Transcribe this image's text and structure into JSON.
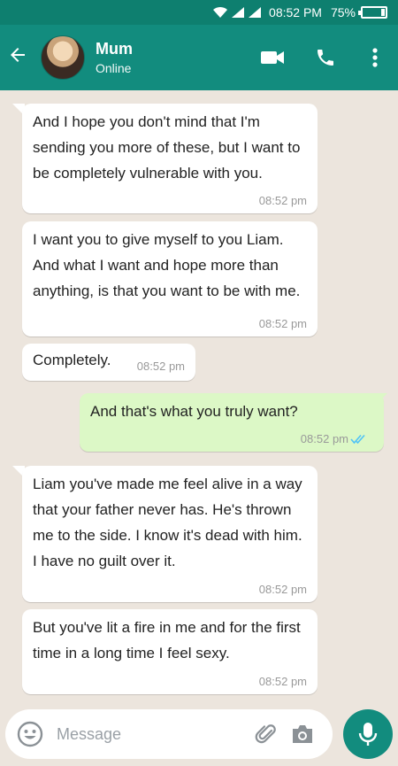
{
  "status_bar": {
    "time": "08:52 PM",
    "battery": "75%"
  },
  "header": {
    "contact_name": "Mum",
    "contact_status": "Online"
  },
  "messages": [
    {
      "direction": "in",
      "text": "And I hope you don't mind that I'm sending you more of these, but I want to be completely vulnerable with you.",
      "time": "08:52 pm"
    },
    {
      "direction": "in",
      "text": "I want you to give myself to you Liam. And what I want and hope more than anything, is that you want to be with me.",
      "time": "08:52 pm"
    },
    {
      "direction": "in",
      "text": "Completely.",
      "time": "08:52 pm"
    },
    {
      "direction": "out",
      "text": "And that's what you truly want?",
      "time": "08:52 pm",
      "ticks": "read"
    },
    {
      "direction": "in",
      "text": "Liam you've made me feel alive in a way that your father never has. He's thrown me to the side. I know it's dead with him. I have no guilt over it.",
      "time": "08:52 pm"
    },
    {
      "direction": "in",
      "text": "But you've lit a fire in me and for the first time in a long time I feel sexy.",
      "time": "08:52 pm"
    }
  ],
  "input": {
    "placeholder": "Message"
  },
  "colors": {
    "header": "#128c7e",
    "status_bar": "#0e7f6f",
    "outgoing_bubble": "#dcf8c6",
    "incoming_bubble": "#ffffff",
    "chat_background": "#ece5dd",
    "read_ticks": "#4fc3f7"
  },
  "icons": [
    "wifi-icon",
    "signal-icon",
    "battery-icon",
    "back-arrow-icon",
    "video-call-icon",
    "phone-icon",
    "more-options-icon",
    "emoji-icon",
    "attach-icon",
    "camera-icon",
    "mic-icon",
    "double-check-icon"
  ]
}
